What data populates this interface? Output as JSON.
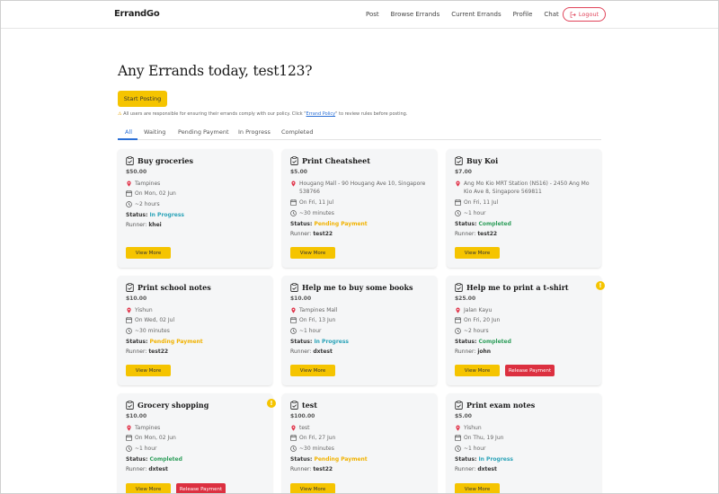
{
  "app": {
    "brand": "ErrandGo"
  },
  "nav": {
    "items": [
      "Post",
      "Browse Errands",
      "Current Errands",
      "Profile",
      "Chat"
    ],
    "logout_label": "Logout"
  },
  "header": {
    "greeting": "Any Errands today, test123?",
    "start_label": "Start Posting",
    "notice_pre": "All users are responsible for ensuring their errands comply with our policy. Click \"",
    "notice_link": "Errand Policy",
    "notice_post": "\" to review rules before posting."
  },
  "tabs": [
    "All",
    "Waiting",
    "Pending Payment",
    "In Progress",
    "Completed"
  ],
  "labels": {
    "status": "Status:",
    "runner": "Runner:",
    "view_more": "View More",
    "release_payment": "Release Payment"
  },
  "colors": {
    "accent": "#f5c400",
    "link": "#2a6fd6",
    "danger": "#dc3040",
    "in_progress": "#2ba3b8",
    "pending": "#f1b200",
    "completed": "#2e9e5b"
  },
  "cards": [
    {
      "title": "Buy groceries",
      "price": "$50.00",
      "location": "Tampines",
      "date": "On Mon, 02 Jun",
      "duration": "~2 hours",
      "status": "In Progress",
      "runner": "khei",
      "alert": false,
      "release": false
    },
    {
      "title": "Print Cheatsheet",
      "price": "$5.00",
      "location": "Hougang Mall - 90 Hougang Ave 10, Singapore 538766",
      "date": "On Fri, 11 Jul",
      "duration": "~30 minutes",
      "status": "Pending Payment",
      "runner": "test22",
      "alert": false,
      "release": false
    },
    {
      "title": "Buy Koi",
      "price": "$7.00",
      "location": "Ang Mo Kio MRT Station (NS16) - 2450 Ang Mo Kio Ave 8, Singapore 569811",
      "date": "On Fri, 11 Jul",
      "duration": "~1 hour",
      "status": "Completed",
      "runner": "test22",
      "alert": false,
      "release": false
    },
    {
      "title": "Print school notes",
      "price": "$10.00",
      "location": "Yishun",
      "date": "On Wed, 02 Jul",
      "duration": "~30 minutes",
      "status": "Pending Payment",
      "runner": "test22",
      "alert": false,
      "release": false
    },
    {
      "title": "Help me to buy some books",
      "price": "$10.00",
      "location": "Tampines Mall",
      "date": "On Fri, 13 Jun",
      "duration": "~1 hour",
      "status": "In Progress",
      "runner": "dxtest",
      "alert": false,
      "release": false
    },
    {
      "title": "Help me to print a t-shirt",
      "price": "$25.00",
      "location": "Jalan Kayu",
      "date": "On Fri, 20 Jun",
      "duration": "~2 hours",
      "status": "Completed",
      "runner": "john",
      "alert": true,
      "release": true
    },
    {
      "title": "Grocery shopping",
      "price": "$10.00",
      "location": "Tampines",
      "date": "On Mon, 02 Jun",
      "duration": "~1 hour",
      "status": "Completed",
      "runner": "dxtest",
      "alert": true,
      "release": true
    },
    {
      "title": "test",
      "price": "$100.00",
      "location": "test",
      "date": "On Fri, 27 Jun",
      "duration": "~30 minutes",
      "status": "Pending Payment",
      "runner": "test22",
      "alert": false,
      "release": false
    },
    {
      "title": "Print exam notes",
      "price": "$5.00",
      "location": "Yishun",
      "date": "On Thu, 19 Jun",
      "duration": "~1 hour",
      "status": "In Progress",
      "runner": "dxtest",
      "alert": false,
      "release": false
    }
  ]
}
